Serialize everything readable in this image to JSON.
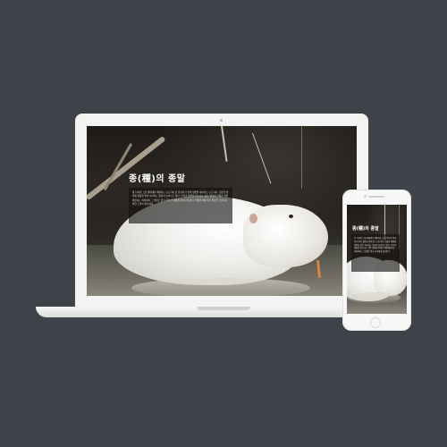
{
  "laptop": {
    "headline": "종(種)의 종말",
    "body": "종 나라의 고유 생태계가 꽤파되는 뉴트리아 한 유전자가 받아 생존을 이어가는 뉴트리아. 건강한 생태계 방중을 받아 사라지는 종들이 늘어나고 있다. 우리가 생물을 잃는다는 것은 생태계 전체가 위험해진다는 의미이며 그 영향은 결국 우리 인간에게 돌아오게 된다. 멸종위기에 처한 종들을 보호하기 위한 노력이 필요하다."
  },
  "phone": {
    "headline": "종(種)의 종말",
    "body": "종 나라의 고유 생태계가 꽤파되는 뉴트리아 한 유전자가 받아 생존을 이어가는 뉴트리아. 건강한 생태계 방중을 받아 사라지는 종들이 늘어나고 있다. 우리가 생물을 잃는다는 것은 생태계 전체가 위험해진다는 의미이며 그 영향은 결국 우리에게 돌아온다."
  },
  "colors": {
    "background": "#3d4349",
    "device": "#f3f3f3",
    "textbox": "rgba(20,18,16,0.62)"
  }
}
